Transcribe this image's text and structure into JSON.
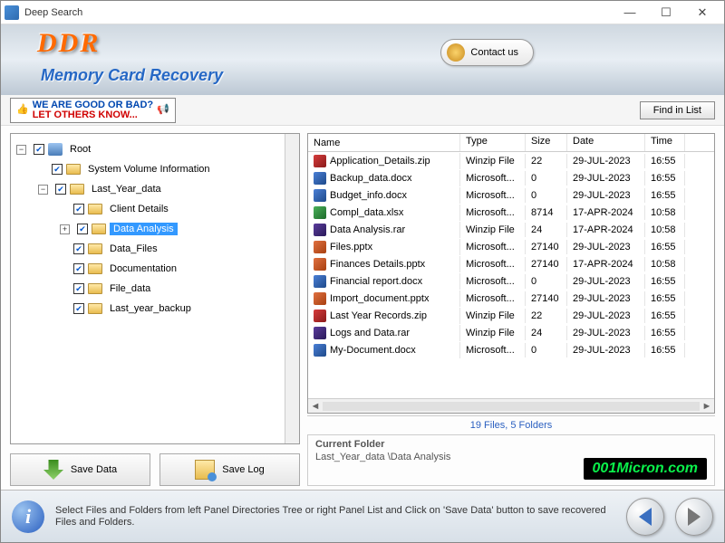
{
  "window": {
    "title": "Deep Search"
  },
  "header": {
    "logo": "DDR",
    "subtitle": "Memory Card Recovery",
    "contact": "Contact us"
  },
  "toolbar": {
    "review_line1": "WE ARE GOOD OR BAD?",
    "review_line2": "LET OTHERS KNOW...",
    "find": "Find in List"
  },
  "tree": {
    "root": "Root",
    "items": [
      {
        "label": "System Volume Information",
        "depth": 1,
        "exp": ""
      },
      {
        "label": "Last_Year_data",
        "depth": 1,
        "exp": "−"
      },
      {
        "label": "Client Details",
        "depth": 2,
        "exp": ""
      },
      {
        "label": "Data Analysis",
        "depth": 2,
        "exp": "+",
        "selected": true
      },
      {
        "label": "Data_Files",
        "depth": 2,
        "exp": ""
      },
      {
        "label": "Documentation",
        "depth": 2,
        "exp": ""
      },
      {
        "label": "File_data",
        "depth": 2,
        "exp": ""
      },
      {
        "label": "Last_year_backup",
        "depth": 2,
        "exp": ""
      }
    ]
  },
  "buttons": {
    "save_data": "Save Data",
    "save_log": "Save Log"
  },
  "columns": {
    "name": "Name",
    "type": "Type",
    "size": "Size",
    "date": "Date",
    "time": "Time"
  },
  "files": [
    {
      "icon": "fi-zip",
      "name": "Application_Details.zip",
      "type": "Winzip File",
      "size": "22",
      "date": "29-JUL-2023",
      "time": "16:55"
    },
    {
      "icon": "fi-doc",
      "name": "Backup_data.docx",
      "type": "Microsoft...",
      "size": "0",
      "date": "29-JUL-2023",
      "time": "16:55"
    },
    {
      "icon": "fi-doc",
      "name": "Budget_info.docx",
      "type": "Microsoft...",
      "size": "0",
      "date": "29-JUL-2023",
      "time": "16:55"
    },
    {
      "icon": "fi-xls",
      "name": "Compl_data.xlsx",
      "type": "Microsoft...",
      "size": "8714",
      "date": "17-APR-2024",
      "time": "10:58"
    },
    {
      "icon": "fi-rar",
      "name": "Data Analysis.rar",
      "type": "Winzip File",
      "size": "24",
      "date": "17-APR-2024",
      "time": "10:58"
    },
    {
      "icon": "fi-ppt",
      "name": "Files.pptx",
      "type": "Microsoft...",
      "size": "27140",
      "date": "29-JUL-2023",
      "time": "16:55"
    },
    {
      "icon": "fi-ppt",
      "name": "Finances Details.pptx",
      "type": "Microsoft...",
      "size": "27140",
      "date": "17-APR-2024",
      "time": "10:58"
    },
    {
      "icon": "fi-doc",
      "name": "Financial report.docx",
      "type": "Microsoft...",
      "size": "0",
      "date": "29-JUL-2023",
      "time": "16:55"
    },
    {
      "icon": "fi-ppt",
      "name": "Import_document.pptx",
      "type": "Microsoft...",
      "size": "27140",
      "date": "29-JUL-2023",
      "time": "16:55"
    },
    {
      "icon": "fi-zip",
      "name": "Last Year Records.zip",
      "type": "Winzip File",
      "size": "22",
      "date": "29-JUL-2023",
      "time": "16:55"
    },
    {
      "icon": "fi-rar",
      "name": "Logs and Data.rar",
      "type": "Winzip File",
      "size": "24",
      "date": "29-JUL-2023",
      "time": "16:55"
    },
    {
      "icon": "fi-doc",
      "name": "My-Document.docx",
      "type": "Microsoft...",
      "size": "0",
      "date": "29-JUL-2023",
      "time": "16:55"
    }
  ],
  "summary": "19 Files, 5 Folders",
  "current": {
    "label": "Current Folder",
    "path": "Last_Year_data \\Data Analysis"
  },
  "watermark": "001Micron.com",
  "footer": {
    "text": "Select Files and Folders from left Panel Directories Tree or right Panel List and Click on 'Save Data' button to save recovered Files and Folders."
  }
}
